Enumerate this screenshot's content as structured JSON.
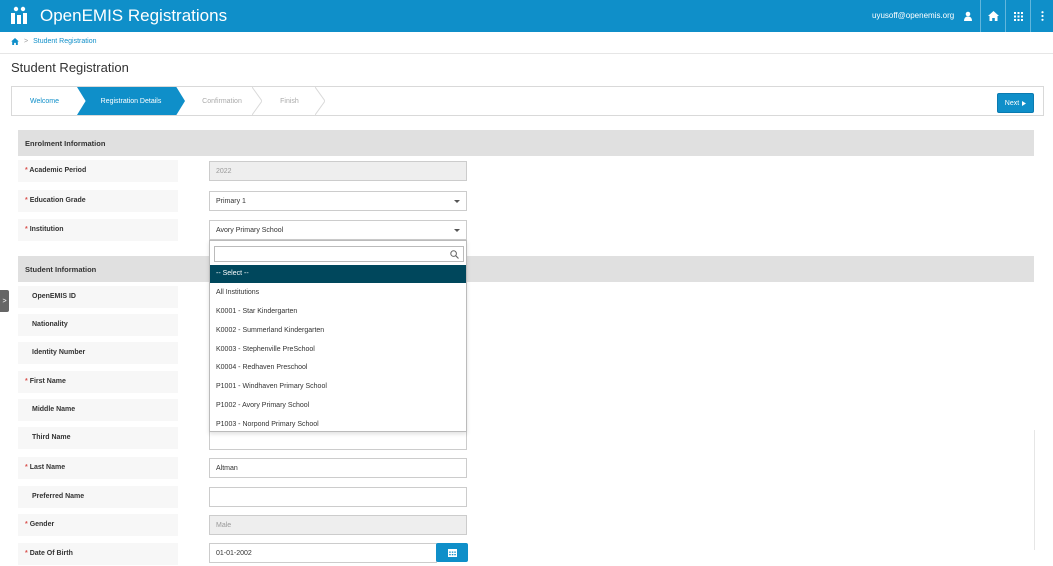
{
  "header": {
    "app_title": "OpenEMIS Registrations",
    "user_email": "uyusoff@openemis.org",
    "icons": [
      "logo-icon",
      "user-icon",
      "home-icon",
      "grid-icon",
      "more-icon"
    ],
    "accent_color": "#0f8fc9"
  },
  "breadcrumb": {
    "home_icon": "home-icon",
    "separator": ">",
    "current": "Student Registration"
  },
  "page": {
    "title": "Student Registration"
  },
  "wizard": {
    "steps": [
      "Welcome",
      "Registration Details",
      "Confirmation",
      "Finish"
    ],
    "active_step": "Registration Details",
    "next_label": "Next"
  },
  "sections": {
    "enrolment": "Enrolment Information",
    "student": "Student Information"
  },
  "enrolment": {
    "academic_period_label": "Academic Period",
    "academic_period_value": "2022",
    "education_grade_label": "Education Grade",
    "education_grade_value": "Primary 1",
    "institution_label": "Institution",
    "institution_value": "Avory Primary School"
  },
  "institution_dropdown": {
    "search_value": "",
    "options": [
      "-- Select --",
      "All Institutions",
      "K0001 - Star Kindergarten",
      "K0002 - Summerland Kindergarten",
      "K0003 - Stephenville PreSchool",
      "K0004 - Redhaven Preschool",
      "P1001 - Windhaven Primary School",
      "P1002 - Avory Primary School",
      "P1003 - Norpond Primary School"
    ],
    "highlighted": "-- Select --",
    "highlight_color": "#00475c"
  },
  "student": {
    "openemis_id_label": "OpenEMIS ID",
    "nationality_label": "Nationality",
    "identity_number_label": "Identity Number",
    "first_name_label": "First Name",
    "middle_name_label": "Middle Name",
    "third_name_label": "Third Name",
    "third_name_value": "",
    "last_name_label": "Last Name",
    "last_name_value": "Altman",
    "preferred_name_label": "Preferred Name",
    "preferred_name_value": "",
    "gender_label": "Gender",
    "gender_value": "Male",
    "dob_label": "Date Of Birth",
    "dob_value": "01-01-2002"
  },
  "required_marker": "*",
  "side_handle_glyph": ">"
}
